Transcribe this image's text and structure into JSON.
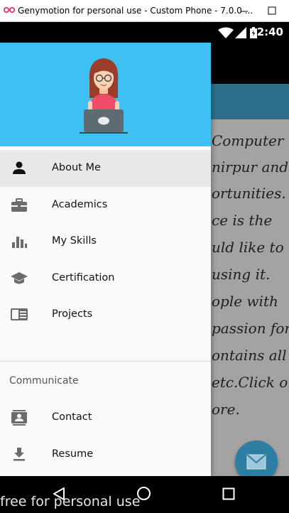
{
  "window": {
    "title": "Genymotion for personal use - Custom Phone - 7.0.0 ...",
    "logo_icon": "genymotion-logo-icon",
    "minimize_icon": "minimize-icon",
    "maximize_icon": "maximize-icon"
  },
  "status_bar": {
    "time": "2:40",
    "icons": [
      "wifi-icon",
      "signal-icon",
      "battery-icon"
    ]
  },
  "drawer": {
    "header_image": "developer-avatar-illustration",
    "header_color": "#3ec1f2",
    "items": [
      {
        "label": "About Me",
        "icon": "person-icon",
        "active": true
      },
      {
        "label": "Academics",
        "icon": "briefcase-icon",
        "active": false
      },
      {
        "label": "My Skills",
        "icon": "bar-chart-icon",
        "active": false
      },
      {
        "label": "Certification",
        "icon": "graduation-cap-icon",
        "active": false
      },
      {
        "label": "Projects",
        "icon": "book-icon",
        "active": false
      }
    ],
    "section_title": "Communicate",
    "section_items": [
      {
        "label": "Contact",
        "icon": "contact-card-icon"
      },
      {
        "label": "Resume",
        "icon": "download-icon"
      }
    ]
  },
  "background_content": {
    "lines": [
      "Computer",
      "nirpur and",
      "ortunities.",
      "ce is the",
      "uld like to",
      "using it.",
      "ople with",
      "passion for",
      "ontains all",
      "etc.Click on",
      "ore."
    ],
    "fab_icon": "mail-icon"
  },
  "nav_bar": {
    "icons": [
      "back-icon",
      "home-icon",
      "recents-icon"
    ]
  },
  "watermark": "free for personal use"
}
